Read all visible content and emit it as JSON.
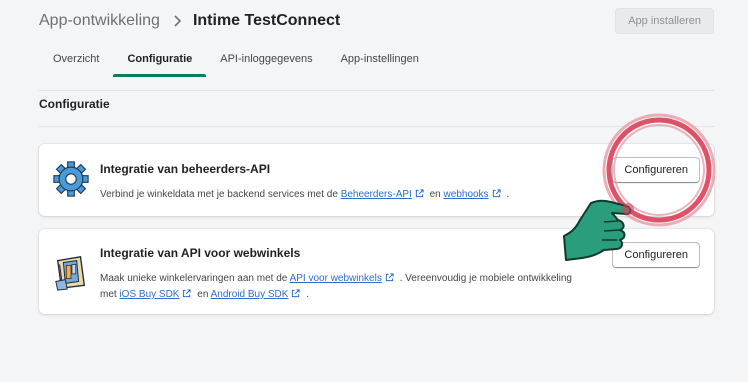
{
  "breadcrumb": {
    "parent": "App-ontwikkeling",
    "current": "Intime TestConnect"
  },
  "header": {
    "install_label": "App installeren"
  },
  "tabs": [
    {
      "label": "Overzicht",
      "active": false
    },
    {
      "label": "Configuratie",
      "active": true
    },
    {
      "label": "API-inloggegevens",
      "active": false
    },
    {
      "label": "App-instellingen",
      "active": false
    }
  ],
  "section": {
    "title": "Configuratie"
  },
  "cards": [
    {
      "title": "Integratie van beheerders-API",
      "desc_prefix": "Verbind je winkeldata met je backend services met de",
      "link1": "Beheerders-API",
      "mid": "en",
      "link2": "webhooks",
      "suffix": ".",
      "button": "Configureren",
      "icon": "gear-icon"
    },
    {
      "title": "Integratie van API voor webwinkels",
      "desc_prefix": "Maak unieke winkelervaringen aan met de",
      "link1": "API voor webwinkels",
      "desc_mid": ". Vereenvoudig je mobiele ontwikkeling met",
      "link2": "iOS Buy SDK",
      "mid": "en",
      "link3": "Android Buy SDK",
      "suffix": ".",
      "button": "Configureren",
      "icon": "storefront-icon"
    }
  ],
  "colors": {
    "accent": "#008060",
    "link": "#2c6ecb",
    "annotation_ring": "#d9415a",
    "annotation_hand": "#2a9d7c"
  }
}
